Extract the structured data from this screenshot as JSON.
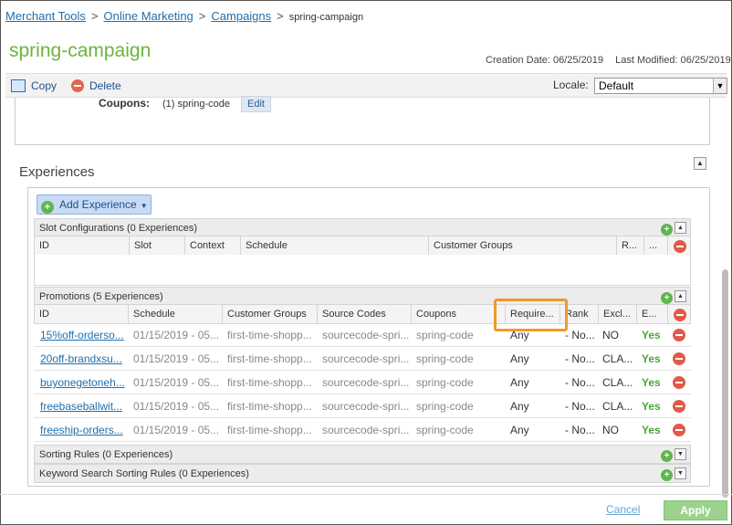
{
  "breadcrumb": {
    "items": [
      "Merchant Tools",
      "Online Marketing",
      "Campaigns"
    ],
    "separator": ">",
    "current": "spring-campaign"
  },
  "page": {
    "title": "spring-campaign",
    "creation_date": "Creation Date: 06/25/2019",
    "last_modified": "Last Modified: 06/25/2019"
  },
  "toolbar": {
    "copy_label": "Copy",
    "delete_label": "Delete",
    "locale_label": "Locale:",
    "locale_value": "Default"
  },
  "coupons": {
    "label": "Coupons:",
    "value": "(1) spring-code",
    "edit_label": "Edit"
  },
  "experiences": {
    "heading": "Experiences",
    "add_button_label": "Add Experience",
    "slot": {
      "title": "Slot Configurations (0 Experiences)",
      "columns": [
        "ID",
        "Slot",
        "Context",
        "Schedule",
        "Customer Groups",
        "R...",
        "..."
      ]
    },
    "promotions": {
      "title": "Promotions (5 Experiences)",
      "columns": [
        "ID",
        "Schedule",
        "Customer Groups",
        "Source Codes",
        "Coupons",
        "Require...",
        "Rank",
        "Excl...",
        "E..."
      ],
      "rows": [
        {
          "id": "15%off-orderso...",
          "schedule": "01/15/2019 - 05...",
          "groups": "first-time-shopp...",
          "source": "sourcecode-spri...",
          "coupons": "spring-code",
          "require": "Any",
          "rank": "- No...",
          "excl": "NO",
          "enabled": "Yes"
        },
        {
          "id": "20off-brandxsu...",
          "schedule": "01/15/2019 - 05...",
          "groups": "first-time-shopp...",
          "source": "sourcecode-spri...",
          "coupons": "spring-code",
          "require": "Any",
          "rank": "- No...",
          "excl": "CLA...",
          "enabled": "Yes"
        },
        {
          "id": "buyonegetoneh...",
          "schedule": "01/15/2019 - 05...",
          "groups": "first-time-shopp...",
          "source": "sourcecode-spri...",
          "coupons": "spring-code",
          "require": "Any",
          "rank": "- No...",
          "excl": "CLA...",
          "enabled": "Yes"
        },
        {
          "id": "freebaseballwit...",
          "schedule": "01/15/2019 - 05...",
          "groups": "first-time-shopp...",
          "source": "sourcecode-spri...",
          "coupons": "spring-code",
          "require": "Any",
          "rank": "- No...",
          "excl": "CLA...",
          "enabled": "Yes"
        },
        {
          "id": "freeship-orders...",
          "schedule": "01/15/2019 - 05...",
          "groups": "first-time-shopp...",
          "source": "sourcecode-spri...",
          "coupons": "spring-code",
          "require": "Any",
          "rank": "- No...",
          "excl": "NO",
          "enabled": "Yes"
        }
      ]
    },
    "sorting_rules": {
      "title": "Sorting Rules (0 Experiences)"
    },
    "keyword_rules": {
      "title": "Keyword Search Sorting Rules (0 Experiences)"
    }
  },
  "footer": {
    "cancel_label": "Cancel",
    "apply_label": "Apply"
  },
  "icons": [
    "copy-icon",
    "delete-icon",
    "chevron-down-icon",
    "add-circle-icon",
    "remove-circle-icon",
    "collapse-up-icon",
    "expand-down-icon"
  ],
  "colors": {
    "title_green": "#6db33f",
    "link_blue": "#1f6fae",
    "yes_green": "#4aa637",
    "highlight_orange": "#ef9a2a",
    "delete_red": "#e05a4a"
  }
}
